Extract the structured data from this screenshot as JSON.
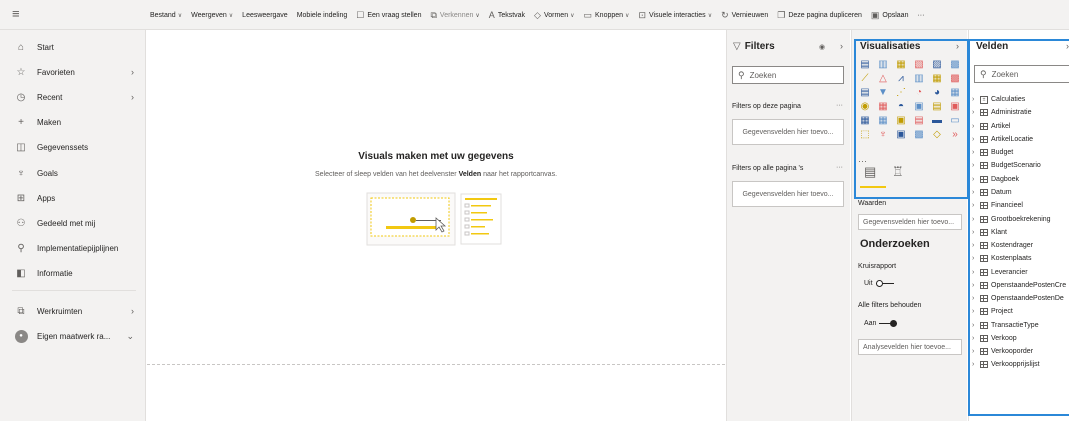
{
  "ribbon": [
    {
      "label": "Bestand",
      "icon": "",
      "chevron": true,
      "dim": false
    },
    {
      "label": "Weergeven",
      "icon": "",
      "chevron": true,
      "dim": false
    },
    {
      "label": "Leesweergave",
      "icon": "",
      "chevron": false,
      "dim": false
    },
    {
      "label": "Mobiele indeling",
      "icon": "",
      "chevron": false,
      "dim": false
    },
    {
      "label": "Een vraag stellen",
      "icon": "☐",
      "chevron": false,
      "dim": false
    },
    {
      "label": "Verkennen",
      "icon": "⧉",
      "chevron": true,
      "dim": true
    },
    {
      "label": "Tekstvak",
      "icon": "A",
      "chevron": false,
      "dim": false
    },
    {
      "label": "Vormen",
      "icon": "◇",
      "chevron": true,
      "dim": false
    },
    {
      "label": "Knoppen",
      "icon": "▭",
      "chevron": true,
      "dim": false
    },
    {
      "label": "Visuele interacties",
      "icon": "⊡",
      "chevron": true,
      "dim": false
    },
    {
      "label": "Vernieuwen",
      "icon": "↻",
      "chevron": false,
      "dim": false
    },
    {
      "label": "Deze pagina dupliceren",
      "icon": "❐",
      "chevron": false,
      "dim": false
    },
    {
      "label": "Opslaan",
      "icon": "▣",
      "chevron": false,
      "dim": false
    }
  ],
  "ribbon_more": "···",
  "nav": {
    "items": [
      {
        "label": "Start",
        "icon": "⌂",
        "name": "start",
        "chevron": false
      },
      {
        "label": "Favorieten",
        "icon": "☆",
        "name": "favorieten",
        "chevron": true
      },
      {
        "label": "Recent",
        "icon": "◷",
        "name": "recent",
        "chevron": true
      },
      {
        "label": "Maken",
        "icon": "+",
        "name": "maken",
        "chevron": false
      },
      {
        "label": "Gegevenssets",
        "icon": "◫",
        "name": "gegevenssets",
        "chevron": false
      },
      {
        "label": "Goals",
        "icon": "♆",
        "name": "goals",
        "chevron": false
      },
      {
        "label": "Apps",
        "icon": "⊞",
        "name": "apps",
        "chevron": false
      },
      {
        "label": "Gedeeld met mij",
        "icon": "⚇",
        "name": "gedeeld",
        "chevron": false
      },
      {
        "label": "Implementatiepijplijnen",
        "icon": "⚲",
        "name": "implementatie",
        "chevron": false
      },
      {
        "label": "Informatie",
        "icon": "◧",
        "name": "informatie",
        "chevron": false
      }
    ],
    "bottom": [
      {
        "label": "Werkruimten",
        "icon": "⧉",
        "name": "werkruimten",
        "chevron": "›"
      },
      {
        "label": "Eigen maatwerk ra...",
        "icon": "avatar",
        "name": "eigen-maatwerk",
        "chevron": "⌄"
      }
    ]
  },
  "canvas": {
    "title": "Visuals maken met uw gegevens",
    "subtitle_before": "Selecteer of sleep velden van het deelvenster ",
    "subtitle_bold": "Velden",
    "subtitle_after": " naar het rapportcanvas."
  },
  "filters": {
    "title": "Filters",
    "search_placeholder": "Zoeken",
    "page_section": "Filters op deze pagina",
    "page_well": "Gegevensvelden hier toevo...",
    "all_section": "Filters op alle pagina 's",
    "all_well": "Gegevensvelden hier toevo...",
    "more": "···"
  },
  "visualizations": {
    "title": "Visualisaties",
    "more": "···",
    "icons": [
      "▤",
      "▥",
      "▦",
      "▧",
      "▨",
      "▩",
      "⟋",
      "△",
      "⩘",
      "▥",
      "▦",
      "▩",
      "▤",
      "▼",
      "⋰",
      "◔",
      "◕",
      "▦",
      "◉",
      "▦",
      "◓",
      "▣",
      "▤",
      "▣",
      "▦",
      "▦",
      "▣",
      "▤",
      "▬",
      "▭",
      "⬚",
      "♆",
      "▣",
      "▩",
      "◇",
      "»"
    ],
    "waarden_label": "Waarden",
    "waarden_well": "Gegevensvelden hier toevo...",
    "onderzoeken_title": "Onderzoeken",
    "kruisrapport_label": "Kruisrapport",
    "kruisrapport_value": "Uit",
    "alle_filters_label": "Alle filters behouden",
    "alle_filters_value": "Aan",
    "analyse_well": "Analysevelden hier toevoe..."
  },
  "velden": {
    "title": "Velden",
    "search_placeholder": "Zoeken",
    "items": [
      {
        "label": "Calculaties",
        "icon": "calc"
      },
      {
        "label": "Administratie",
        "icon": "table"
      },
      {
        "label": "Artikel",
        "icon": "table"
      },
      {
        "label": "ArtikelLocatie",
        "icon": "table"
      },
      {
        "label": "Budget",
        "icon": "table"
      },
      {
        "label": "BudgetScenario",
        "icon": "table"
      },
      {
        "label": "Dagboek",
        "icon": "table"
      },
      {
        "label": "Datum",
        "icon": "table"
      },
      {
        "label": "Financieel",
        "icon": "table"
      },
      {
        "label": "Grootboekrekening",
        "icon": "table"
      },
      {
        "label": "Klant",
        "icon": "table"
      },
      {
        "label": "Kostendrager",
        "icon": "table"
      },
      {
        "label": "Kostenplaats",
        "icon": "table"
      },
      {
        "label": "Leverancier",
        "icon": "table"
      },
      {
        "label": "OpenstaandePostenCre",
        "icon": "table"
      },
      {
        "label": "OpenstaandePostenDe",
        "icon": "table"
      },
      {
        "label": "Project",
        "icon": "table"
      },
      {
        "label": "TransactieType",
        "icon": "table"
      },
      {
        "label": "Verkoop",
        "icon": "table"
      },
      {
        "label": "Verkooporder",
        "icon": "table"
      },
      {
        "label": "Verkoopprijslijst",
        "icon": "table"
      }
    ]
  },
  "colors": {
    "accent_blue": "#2b88d8",
    "accent_yellow": "#f2c811",
    "panel_bg": "#f3f2f1"
  }
}
